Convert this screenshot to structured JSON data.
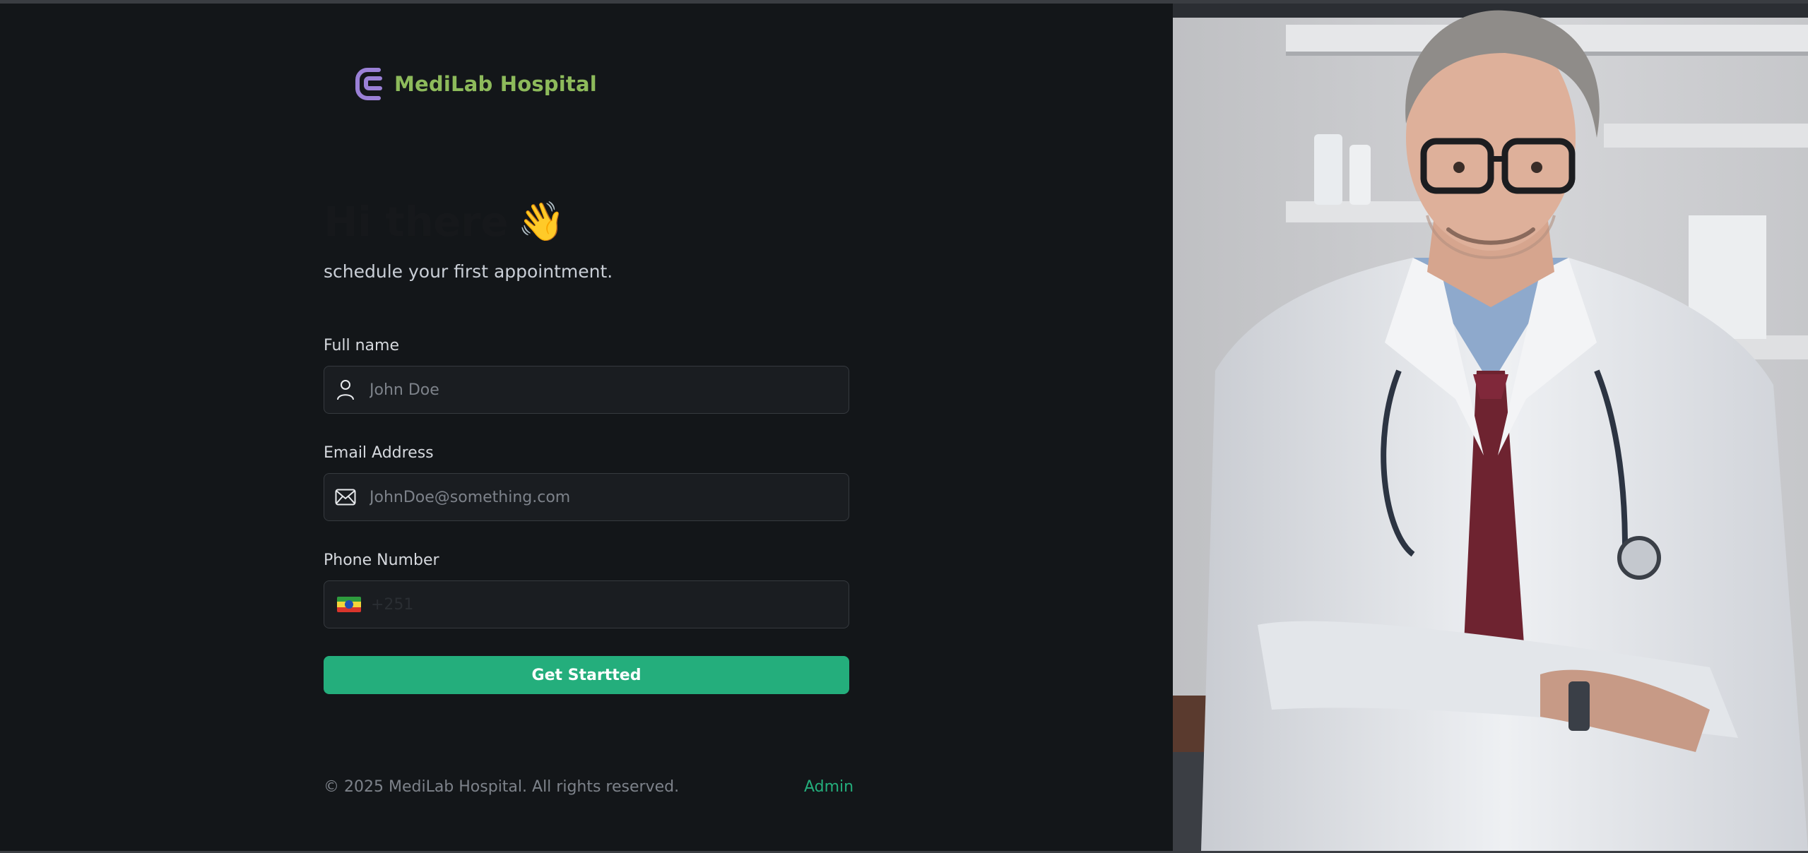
{
  "brand": {
    "name": "MediLab Hospital",
    "logo_icon": "medilab-logo-icon"
  },
  "hero": {
    "title": "Hi there",
    "emoji": "👋",
    "subtitle": "schedule your first appointment."
  },
  "form": {
    "full_name": {
      "label": "Full name",
      "placeholder": "John Doe",
      "icon": "user-icon"
    },
    "email": {
      "label": "Email Address",
      "placeholder": "JohnDoe@something.com",
      "icon": "mail-icon"
    },
    "phone": {
      "label": "Phone Number",
      "prefix": "+251",
      "country_flag": "ethiopia-flag-icon"
    },
    "submit_label": "Get Startted"
  },
  "footer": {
    "copyright": "© 2025 MediLab Hospital. All rights reserved.",
    "admin_link": "Admin"
  },
  "colors": {
    "background": "#131619",
    "accent_green": "#24ae7c",
    "brand_text": "#8dba5b",
    "logo_purple": "#9a80d6",
    "field_bg": "#1a1d21",
    "field_border": "#363a3f"
  },
  "hero_image": {
    "subject": "doctor-portrait-image"
  }
}
